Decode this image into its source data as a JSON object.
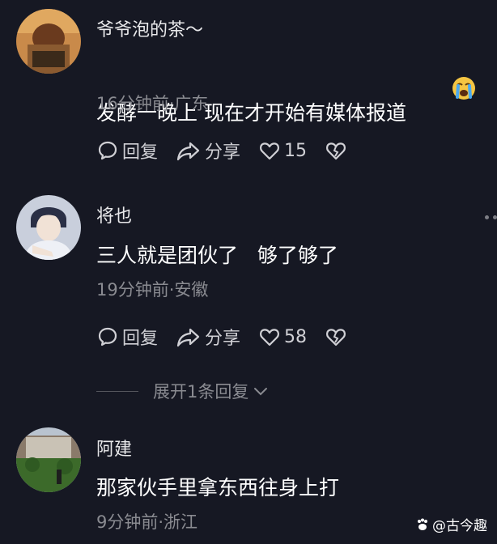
{
  "comments": [
    {
      "username": "爷爷泡的茶～",
      "text": "发酵一晚上 现在才开始有媒体报道",
      "emoji": "crying-face-emoji",
      "meta": "16分钟前·广东",
      "reply_label": "回复",
      "share_label": "分享",
      "like_count": "15"
    },
    {
      "username": "将也",
      "text": "三人就是团伙了   够了够了",
      "meta": "19分钟前·安徽",
      "reply_label": "回复",
      "share_label": "分享",
      "like_count": "58"
    },
    {
      "username": "阿建",
      "text": "那家伙手里拿东西往身上打",
      "meta": "9分钟前·浙江"
    }
  ],
  "expand_replies": "展开1条回复",
  "watermark": "@古今趣",
  "colors": {
    "background": "#161823",
    "secondary_text": "#8a8b91"
  }
}
